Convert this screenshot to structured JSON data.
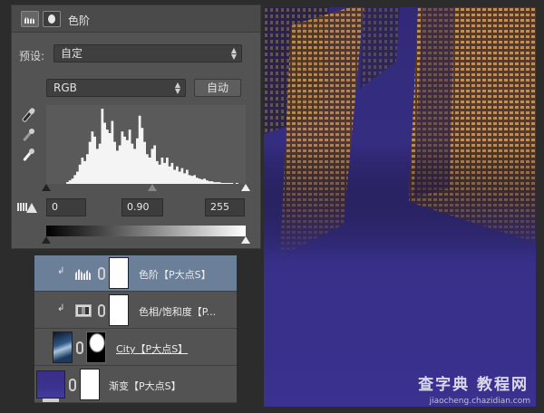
{
  "properties": {
    "title": "色阶",
    "preset_label": "预设:",
    "preset_value": "自定",
    "channel_value": "RGB",
    "auto_button": "自动",
    "input_black": "0",
    "input_gamma": "0.90",
    "input_white": "255"
  },
  "layers": [
    {
      "name": "色阶【P大点S】",
      "type": "levels-adjustment",
      "clipped": true,
      "selected": true
    },
    {
      "name": "色相/饱和度【P...",
      "type": "hue-saturation-adjustment",
      "clipped": true,
      "selected": false
    },
    {
      "name": "City【P大点S】",
      "type": "image-with-mask",
      "clipped": false,
      "selected": false
    },
    {
      "name": "渐变【P大点S】",
      "type": "gradient-fill",
      "clipped": false,
      "selected": false
    }
  ],
  "canvas": {
    "watermark": "查字典 教程网",
    "watermark_url": "jiaocheng.chazidian.com",
    "background_color": "#372f86",
    "building_color": "#b8781c"
  },
  "histogram_shape": [
    0,
    0,
    0,
    0,
    0,
    0,
    0,
    0,
    2,
    4,
    6,
    10,
    14,
    22,
    30,
    26,
    34,
    48,
    60,
    54,
    40,
    46,
    86,
    70,
    62,
    58,
    72,
    48,
    38,
    44,
    60,
    54,
    50,
    62,
    46,
    40,
    52,
    78,
    64,
    48,
    34,
    30,
    40,
    44,
    26,
    22,
    30,
    24,
    30,
    20,
    24,
    16,
    20,
    14,
    18,
    12,
    16,
    10,
    9,
    10,
    7,
    6,
    5,
    6,
    4,
    3,
    3,
    2,
    2,
    2,
    1,
    1,
    1,
    1,
    1,
    0,
    1,
    0,
    0,
    0
  ]
}
